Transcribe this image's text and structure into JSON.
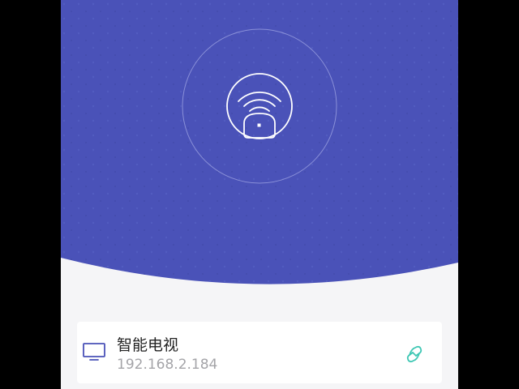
{
  "colors": {
    "hero_background": "#4a52b8",
    "hero_ring": "#8a90d8",
    "icon_stroke": "#ffffff",
    "page_background": "#f5f5f7",
    "card_background": "#ffffff",
    "device_name_color": "#222222",
    "device_ip_color": "#a4a4a8",
    "tv_icon_color": "#4a52b8",
    "link_icon_color": "#3fc7b4"
  },
  "hero": {
    "icon": "wifi-projector-icon"
  },
  "device": {
    "icon": "tv-icon",
    "name": "智能电视",
    "ip": "192.168.2.184",
    "action_icon": "link-icon"
  }
}
